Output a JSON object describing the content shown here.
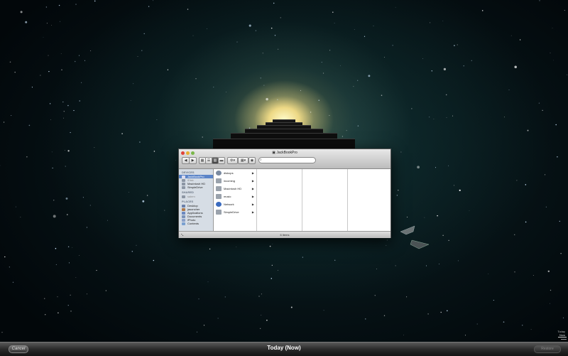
{
  "finder": {
    "title": "JackBookPro",
    "toolbar": {
      "back": "◀",
      "forward": "▶",
      "action": "⚙▾",
      "arrange": "▦▾",
      "eye": "👁",
      "search_placeholder": ""
    },
    "sidebar": {
      "sections": [
        {
          "heading": "DEVICES",
          "items": [
            {
              "label": "JackBookPro",
              "icon": "laptop-icon",
              "selected": true
            },
            {
              "label": "iDisk",
              "icon": "idisk-icon"
            },
            {
              "label": "Macintosh HD",
              "icon": "disk-icon"
            },
            {
              "label": "SimpleDrive",
              "icon": "disk-icon"
            }
          ]
        },
        {
          "heading": "SHARED",
          "items": [
            {
              "label": "salem",
              "icon": "server-icon"
            }
          ]
        },
        {
          "heading": "PLACES",
          "items": [
            {
              "label": "Desktop",
              "icon": "desktop-icon"
            },
            {
              "label": "jasoncher",
              "icon": "home-icon"
            },
            {
              "label": "Applications",
              "icon": "applications-icon"
            },
            {
              "label": "Documents",
              "icon": "documents-icon"
            },
            {
              "label": "iPhoto",
              "icon": "iphoto-icon"
            },
            {
              "label": "Contents",
              "icon": "folder-icon"
            }
          ]
        }
      ]
    },
    "column1": [
      {
        "label": "diskops",
        "icon": "disk-icon",
        "color": "#7a8aa0"
      },
      {
        "label": "incoming",
        "icon": "disk-icon",
        "color": "#9aa2ac"
      },
      {
        "label": "Macintosh HD",
        "icon": "disk-icon",
        "color": "#9aa2ac"
      },
      {
        "label": "music",
        "icon": "disk-icon",
        "color": "#9aa2ac"
      },
      {
        "label": "Network",
        "icon": "network-icon",
        "color": "#3a6bbf"
      },
      {
        "label": "SimpleDrive",
        "icon": "disk-icon",
        "color": "#9aa2ac"
      }
    ],
    "status": "6 items"
  },
  "bottombar": {
    "cancel_label": "Cancel",
    "date_label": "Today (Now)",
    "restore_label": "Restore"
  },
  "timeline": {
    "today_label": "Today",
    "now_label": "Now"
  }
}
